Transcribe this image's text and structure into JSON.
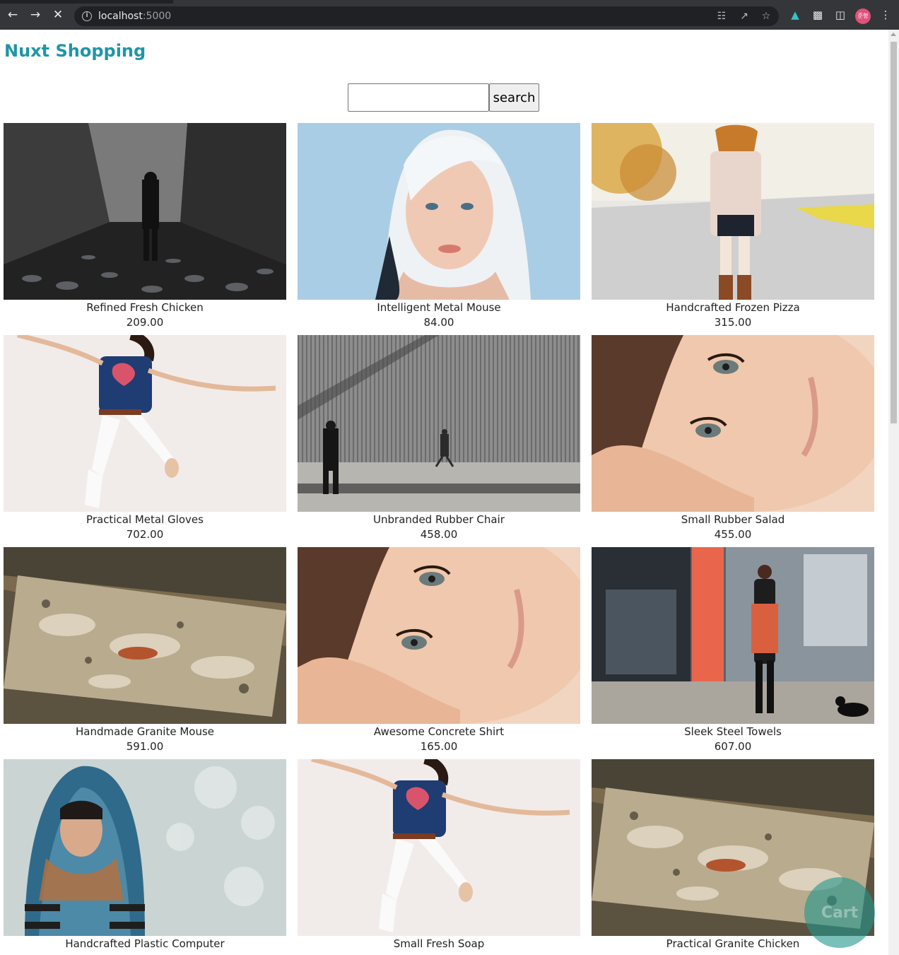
{
  "browser": {
    "url_host": "localhost",
    "url_port": ":5000",
    "profile_initials": "준형"
  },
  "site": {
    "title": "Nuxt Shopping"
  },
  "search": {
    "placeholder": "",
    "value": "",
    "button_label": "search"
  },
  "products": [
    {
      "name": "Refined Fresh Chicken",
      "price": "209.00",
      "image": "man-in-concrete-corridor"
    },
    {
      "name": "Intelligent Metal Mouse",
      "price": "84.00",
      "image": "white-haired-woman-portrait"
    },
    {
      "name": "Handcrafted Frozen Pizza",
      "price": "315.00",
      "image": "woman-in-coat-autumn-road"
    },
    {
      "name": "Practical Metal Gloves",
      "price": "702.00",
      "image": "woman-jumping-white-jeans"
    },
    {
      "name": "Unbranded Rubber Chair",
      "price": "458.00",
      "image": "men-walking-by-metal-wall"
    },
    {
      "name": "Small Rubber Salad",
      "price": "455.00",
      "image": "woman-lying-face-closeup"
    },
    {
      "name": "Handmade Granite Mouse",
      "price": "591.00",
      "image": "rock-climbing-boulder"
    },
    {
      "name": "Awesome Concrete Shirt",
      "price": "165.00",
      "image": "woman-lying-face-closeup"
    },
    {
      "name": "Sleek Steel Towels",
      "price": "607.00",
      "image": "woman-walking-dog-street"
    },
    {
      "name": "Handcrafted Plastic Computer",
      "price": "",
      "image": "woman-in-scarf-bokeh"
    },
    {
      "name": "Small Fresh Soap",
      "price": "",
      "image": "woman-jumping-white-jeans"
    },
    {
      "name": "Practical Granite Chicken",
      "price": "",
      "image": "rock-climbing-boulder"
    }
  ],
  "cart": {
    "label": "Cart"
  }
}
